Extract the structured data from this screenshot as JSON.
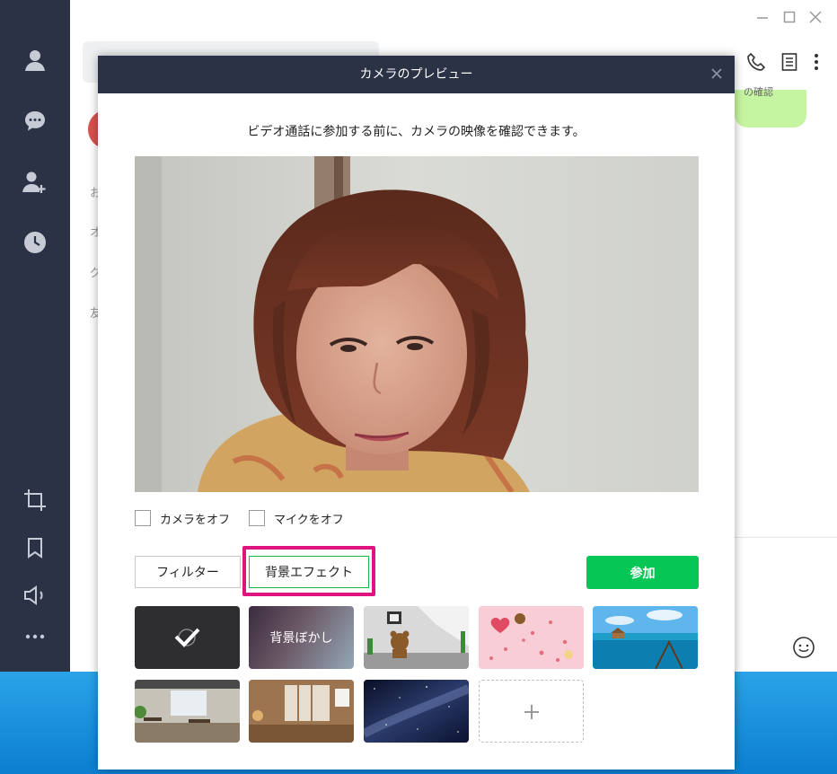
{
  "dialog": {
    "title": "カメラのプレビュー",
    "description": "ビデオ通話に参加する前に、カメラの映像を確認できます。",
    "camera_off_label": "カメラをオフ",
    "mic_off_label": "マイクをオフ",
    "tabs": [
      {
        "label": "フィルター",
        "active": false
      },
      {
        "label": "背景エフェクト",
        "active": true
      }
    ],
    "join_label": "参加",
    "backgrounds": [
      {
        "name": "none",
        "selected": true
      },
      {
        "name": "blur",
        "label": "背景ぼかし"
      },
      {
        "name": "room-bear"
      },
      {
        "name": "pink-hearts"
      },
      {
        "name": "ocean-bungalow"
      },
      {
        "name": "cafe-interior"
      },
      {
        "name": "wooden-room"
      },
      {
        "name": "night-sky"
      },
      {
        "name": "add-background"
      }
    ]
  },
  "list_fragments": [
    "お",
    "オ",
    "グ",
    "友"
  ],
  "bubble_fragment": "の確認",
  "colors": {
    "sidebar": "#2b3245",
    "accent_green": "#06c755",
    "highlight": "#e0147e",
    "bubble": "#c6f5a1"
  },
  "icons": {
    "sidebar_top": [
      "person-icon",
      "chat-icon",
      "add-friend-icon",
      "clock-icon"
    ],
    "sidebar_bottom": [
      "crop-icon",
      "bookmark-icon",
      "speaker-icon",
      "more-icon"
    ],
    "chat_header": [
      "phone-icon",
      "note-icon",
      "kebab-icon"
    ]
  }
}
